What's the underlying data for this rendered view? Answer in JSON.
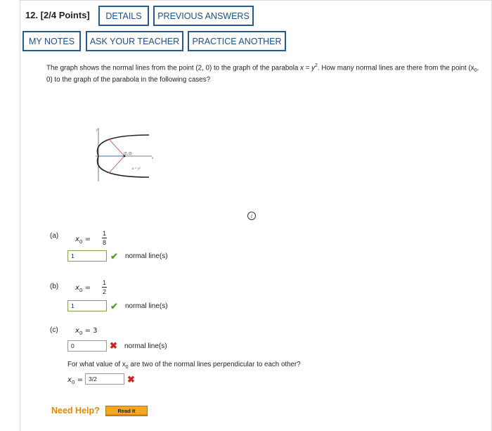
{
  "question": {
    "number": "12. [2/4 Points]",
    "buttons": {
      "details": "DETAILS",
      "previous": "PREVIOUS ANSWERS",
      "notes": "MY NOTES",
      "ask": "ASK YOUR TEACHER",
      "practice": "PRACTICE ANOTHER"
    },
    "prompt_a": "The graph shows the normal lines from the point (2, 0) to the graph of the parabola ",
    "prompt_eq": "x = y",
    "prompt_exp": "2",
    "prompt_b": ". How many normal lines are there from the point (x",
    "prompt_sub": "0",
    "prompt_c": ", 0) to the graph of the parabola in the following cases?",
    "graph_point_label": "(2, 0)",
    "graph_curve_label": "x = y²",
    "graph_x_axis": "x",
    "graph_y_axis": "y",
    "info_icon_glyph": "i"
  },
  "parts": [
    {
      "label": "(a)",
      "var": "x",
      "sub": "0",
      "eq": "=",
      "num": "1",
      "den": "8",
      "answer": "1",
      "suffix": "normal line(s)",
      "status": "correct"
    },
    {
      "label": "(b)",
      "var": "x",
      "sub": "0",
      "eq": "=",
      "num": "1",
      "den": "2",
      "answer": "1",
      "suffix": "normal line(s)",
      "status": "correct"
    },
    {
      "label": "(c)",
      "var": "x",
      "sub": "0",
      "eq": "= 3",
      "answer": "0",
      "suffix": "normal line(s)",
      "status": "incorrect"
    }
  ],
  "followup": {
    "text_a": "For what value of x",
    "text_sub": "0",
    "text_b": " are two of the normal lines perpendicular to each other?",
    "var": "x",
    "sub": "0",
    "eq": "=",
    "answer": "3/2",
    "status": "incorrect"
  },
  "help": {
    "label": "Need Help?",
    "read_it": "Read It"
  },
  "marks": {
    "correct": "✔",
    "incorrect": "✖"
  },
  "colors": {
    "button_border": "#2a5a8a",
    "correct": "#5a9e2f",
    "incorrect": "#cc2222",
    "help": "#e08a00",
    "read_it_bg": "#f5a623"
  }
}
